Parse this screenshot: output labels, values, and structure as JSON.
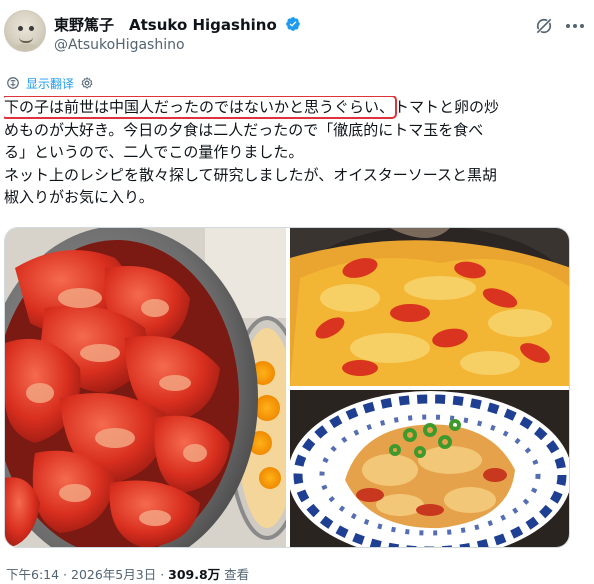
{
  "author": {
    "display_name": "東野篤子　Atsuko Higashino",
    "handle": "@AtsukoHigashino",
    "verified": true,
    "avatar_icon": "avatar-image"
  },
  "header_icons": {
    "grok": "grok-icon",
    "more": "more-options-icon"
  },
  "translate": {
    "label": "显示翻译",
    "icon": "settings-gear-icon"
  },
  "tweet": {
    "highlighted_text": "下の子は前世は中国人だったのではないかと思うぐらい、",
    "line1_rest": "トマトと卵の炒",
    "line2": "めものが大好き。今日の夕食は二人だったので「徹底的にトマ玉を食べ",
    "line3": "る」というので、二人でこの量作りました。",
    "line4": "ネット上のレシピを散々探して研究しましたが、オイスターソースと黒胡",
    "line5": "椒入りがお気に入り。",
    "highlight_color": "#e0323a"
  },
  "media": {
    "images": [
      {
        "name": "tomato-bowl-photo"
      },
      {
        "name": "stir-fry-pan-photo"
      },
      {
        "name": "plated-dish-photo"
      }
    ]
  },
  "footer": {
    "time": "下午6:14",
    "sep1": " · ",
    "date": "2026年5月3日",
    "sep2": " · ",
    "views": "309.8万",
    "views_label": " 查看"
  },
  "colors": {
    "link": "#1d9bf0",
    "muted": "#536471",
    "text": "#0f1419",
    "verified": "#1d9bf0"
  }
}
